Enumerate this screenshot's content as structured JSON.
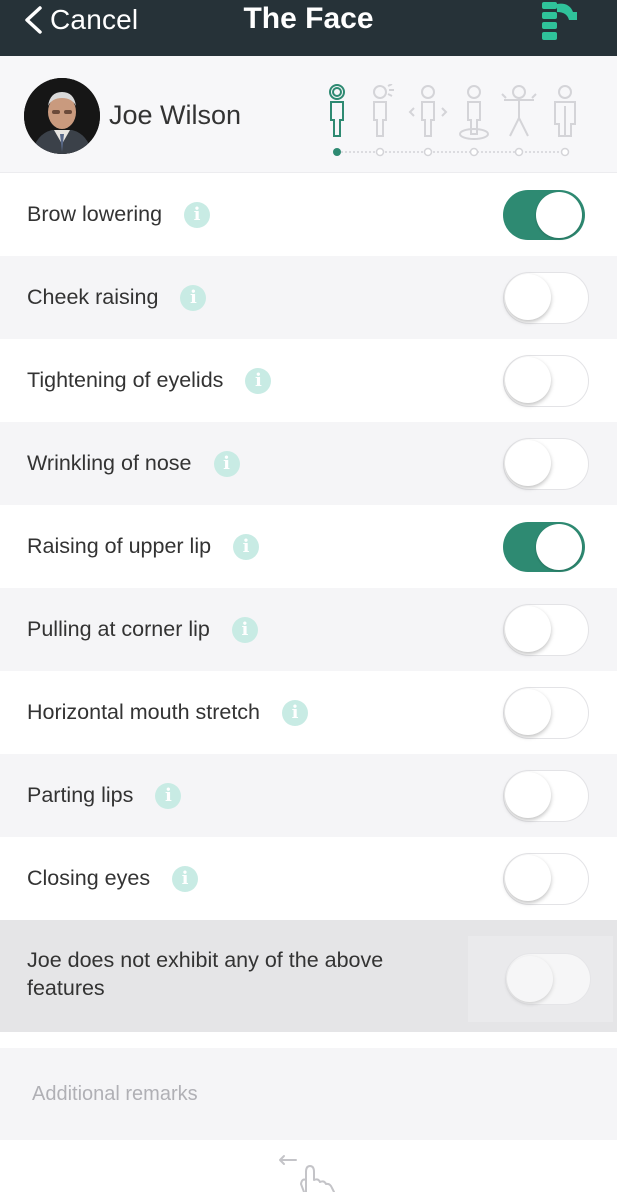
{
  "nav": {
    "back_label": "Cancel",
    "title": "The Face",
    "bar_color": "#263238",
    "accent": "#2e8a72"
  },
  "patient": {
    "name": "Joe Wilson",
    "stage_icons": [
      "person-head-icon",
      "person-speech-icon",
      "person-arrows-icon",
      "person-floor-icon",
      "person-body-icon",
      "person-full-icon"
    ],
    "active_stage": 0
  },
  "features": [
    {
      "label": "Brow lowering",
      "on": true
    },
    {
      "label": "Cheek raising",
      "on": false
    },
    {
      "label": "Tightening of eyelids",
      "on": false
    },
    {
      "label": "Wrinkling of nose",
      "on": false
    },
    {
      "label": "Raising of upper lip",
      "on": true
    },
    {
      "label": "Pulling at corner lip",
      "on": false
    },
    {
      "label": "Horizontal mouth stretch",
      "on": false
    },
    {
      "label": "Parting lips",
      "on": false
    },
    {
      "label": "Closing eyes",
      "on": false
    }
  ],
  "none_option": {
    "label": "Joe does not exhibit any of the above features",
    "on": false
  },
  "remarks": {
    "placeholder": "Additional remarks"
  },
  "footer": {
    "icon": "swipe-back-hand-icon"
  }
}
